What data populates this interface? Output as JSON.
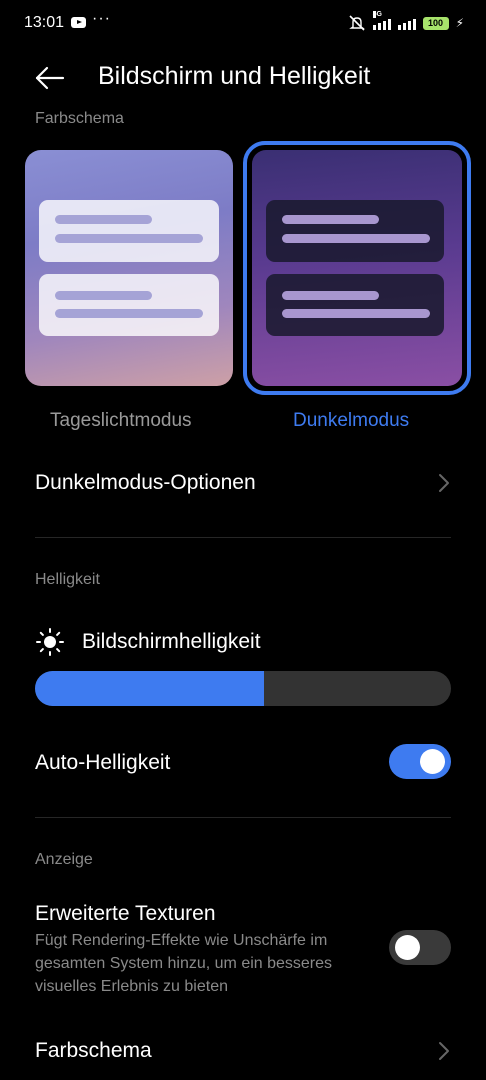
{
  "status_bar": {
    "time": "13:01",
    "more": "···",
    "network": "5G",
    "battery": "100",
    "icons": [
      "youtube-icon",
      "mute-icon",
      "signal-icon",
      "battery-icon",
      "charging-icon"
    ]
  },
  "header": {
    "title": "Bildschirm und Helligkeit",
    "back_icon": "arrow-left-icon"
  },
  "color_scheme_section": {
    "label": "Farbschema",
    "options": [
      {
        "label": "Tageslichtmodus",
        "selected": false
      },
      {
        "label": "Dunkelmodus",
        "selected": true
      }
    ]
  },
  "dark_mode_options": {
    "label": "Dunkelmodus-Optionen"
  },
  "brightness_section": {
    "label": "Helligkeit",
    "slider_label": "Bildschirmhelligkeit",
    "slider_value_fraction": 0.55,
    "auto_label": "Auto-Helligkeit",
    "auto_enabled": true
  },
  "display_section": {
    "label": "Anzeige",
    "textures_title": "Erweiterte Texturen",
    "textures_desc": "Fügt Rendering-Effekte wie Unschärfe im gesamten System hinzu, um ein besseres visuelles Erlebnis zu bieten",
    "textures_enabled": false,
    "color_scheme_label": "Farbschema"
  },
  "colors": {
    "accent": "#3e7bf0",
    "background": "#000000",
    "secondary_text": "#8a8a8a"
  }
}
